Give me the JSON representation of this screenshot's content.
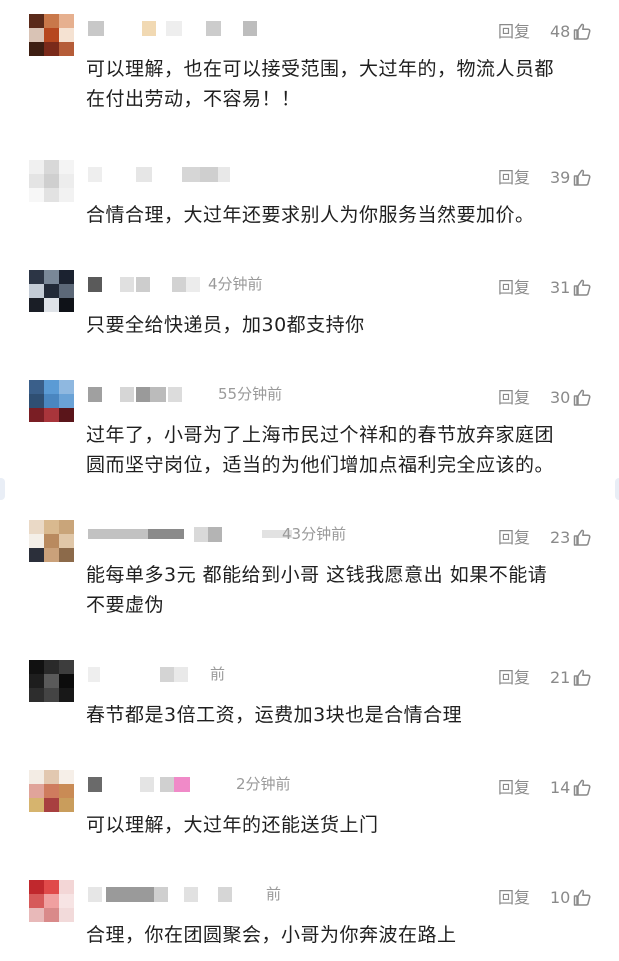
{
  "comments": [
    {
      "time": "",
      "reply": "回复",
      "likes": "48",
      "line1": "可以理解，也在可以接受范围，大过年的，物流人员都",
      "line2": "在付出劳动，不容易！！",
      "avatar_colors": [
        "#5a2a1a",
        "#c9784a",
        "#e6b08f",
        "#d9c3b5",
        "#b6471f",
        "#f5e2d2",
        "#3d1e12",
        "#7a2a1a",
        "#b55c38"
      ],
      "name_colors": [
        "#c8c8c8",
        "#f1d9b3",
        "#eeeeee",
        "#cccccc",
        "#bdbdbd"
      ]
    },
    {
      "time": "",
      "reply": "回复",
      "likes": "39",
      "line1": "合情合理，大过年还要求别人为你服务当然要加价。",
      "line2": "",
      "avatar_colors": [
        "#f0f0f0",
        "#d8d8d8",
        "#f4f4f4",
        "#e4e4e4",
        "#cfcfcf",
        "#ededed",
        "#f7f7f7",
        "#e2e2e2",
        "#f2f2f2"
      ],
      "name_colors": [
        "#eeeeee",
        "#e6e6e6",
        "#d6d6d6",
        "#cfcfcf",
        "#e8e8e8"
      ]
    },
    {
      "time": "4分钟前",
      "reply": "回复",
      "likes": "31",
      "line1": "只要全给快递员，加30都支持你",
      "line2": "",
      "avatar_colors": [
        "#2c3545",
        "#7a8898",
        "#1b2230",
        "#c4ccd6",
        "#222a38",
        "#5c6878",
        "#1a1e26",
        "#dfe3e8",
        "#0f1218"
      ],
      "name_colors": [
        "#5a5a5a",
        "#e0e0e0",
        "#cdcdcd",
        "#d2d2d2",
        "#ececec"
      ]
    },
    {
      "time": "55分钟前",
      "reply": "回复",
      "likes": "30",
      "line1": "过年了，小哥为了上海市民过个祥和的春节放弃家庭团",
      "line2": "圆而坚守岗位，适当的为他们增加点福利完全应该的。",
      "avatar_colors": [
        "#3a5f8a",
        "#5b9bd5",
        "#8fb8e0",
        "#2f4f73",
        "#4a86c0",
        "#6aa2d6",
        "#7a1e24",
        "#a9353b",
        "#5a151a"
      ],
      "name_colors": [
        "#a0a0a0",
        "#d6d6d6",
        "#9a9a9a",
        "#bbbbbb",
        "#dcdcdc"
      ]
    },
    {
      "time": "43分钟前",
      "reply": "回复",
      "likes": "23",
      "line1": "能每单多3元 都能给到小哥 这钱我愿意出 如果不能请",
      "line2": "不要虚伪",
      "avatar_colors": [
        "#ead9c6",
        "#d9b98f",
        "#c9a57a",
        "#f4efe8",
        "#b98a5f",
        "#e0c7a8",
        "#2b2f3a",
        "#caa17a",
        "#8c6a4a"
      ],
      "name_colors": [
        "#c2c2c2",
        "#8a8a8a",
        "#d9d9d9",
        "#b4b4b4",
        "#e2e2e2"
      ]
    },
    {
      "time": "前",
      "reply": "回复",
      "likes": "21",
      "line1": "春节都是3倍工资，运费加3块也是合情合理",
      "line2": "",
      "avatar_colors": [
        "#111111",
        "#2a2a2a",
        "#3d3d3d",
        "#1e1e1e",
        "#5a5a5a",
        "#0c0c0c",
        "#2d2d2d",
        "#444444",
        "#181818"
      ],
      "name_colors": [
        "#eeeeee",
        "#d4d4d4",
        "#e9e9e9",
        "#d8d8d8",
        "#efefef"
      ]
    },
    {
      "time": "2分钟前",
      "reply": "回复",
      "likes": "14",
      "line1": "可以理解，大过年的还能送货上门",
      "line2": "",
      "avatar_colors": [
        "#f3ece4",
        "#e2c8b0",
        "#f6efe8",
        "#e0a49a",
        "#cf7c5e",
        "#c98b55",
        "#d6b46e",
        "#a84040",
        "#c99d5c"
      ],
      "name_colors": [
        "#6a6a6a",
        "#e4e4e4",
        "#d0d0d0",
        "#f08ac8",
        "#dedede"
      ]
    },
    {
      "time": "前",
      "reply": "回复",
      "likes": "10",
      "line1": "合理，你在团圆聚会，小哥为你奔波在路上",
      "line2": "",
      "avatar_colors": [
        "#c0282d",
        "#e04a4a",
        "#f3d6d6",
        "#d65a5a",
        "#f0a0a0",
        "#f7e4e4",
        "#e8b9b9",
        "#d98a8a",
        "#f2dada"
      ],
      "name_colors": [
        "#e6e6e6",
        "#9a9a9a",
        "#cfcfcf",
        "#e1e1e1",
        "#d6d6d6"
      ]
    }
  ]
}
